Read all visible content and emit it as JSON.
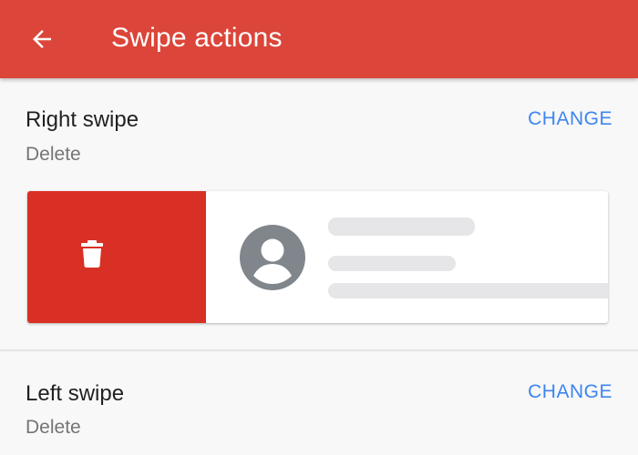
{
  "app_bar": {
    "title": "Swipe actions",
    "background_color": "#dc4539",
    "back_icon": "arrow-back-icon"
  },
  "right_swipe": {
    "title": "Right swipe",
    "action": "Delete",
    "change_label": "CHANGE",
    "preview": {
      "action_color": "#d93025",
      "action_icon": "trash-icon",
      "avatar_icon": "account-circle-icon"
    }
  },
  "left_swipe": {
    "title": "Left swipe",
    "action": "Delete",
    "change_label": "CHANGE"
  },
  "accent_color": "#3d85f0"
}
